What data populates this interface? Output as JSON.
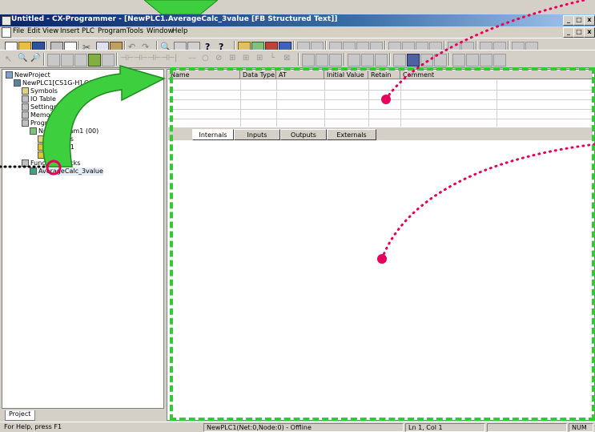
{
  "window": {
    "title": "Untitled - CX-Programmer - [NewPLC1.AverageCalc_3value [FB Structured Text]]",
    "controls": [
      "_",
      "□",
      "x"
    ],
    "doc_controls": [
      "_",
      "□",
      "x"
    ]
  },
  "menu": [
    "File",
    "Edit",
    "View",
    "Insert",
    "PLC",
    "Program",
    "Tools",
    "Window",
    "Help"
  ],
  "tree": {
    "project": "NewProject",
    "plc": "NewPLC1[CS1G-H] Offline",
    "items": [
      "Symbols",
      "IO Table",
      "Settings",
      "Memory",
      "Programs",
      "NewProgram1 (00)",
      "Symbols",
      "Section1",
      "END",
      "Function Blocks",
      "AverageCalc_3value"
    ]
  },
  "project_tab": "Project",
  "grid": {
    "headers": [
      "Name",
      "Data Type",
      "AT",
      "Initial Value",
      "Retain",
      "Comment"
    ]
  },
  "tabs": [
    "Internals",
    "Inputs",
    "Outputs",
    "Externals"
  ],
  "status": {
    "help": "For Help, press F1",
    "connection": "NewPLC1(Net:0,Node:0) - Offline",
    "position": "Ln 1, Col 1",
    "num": "NUM"
  },
  "colors": {
    "accent_green": "#2ecc2e",
    "highlight_pink": "#e8005a",
    "titlebar": "#0a246a"
  }
}
